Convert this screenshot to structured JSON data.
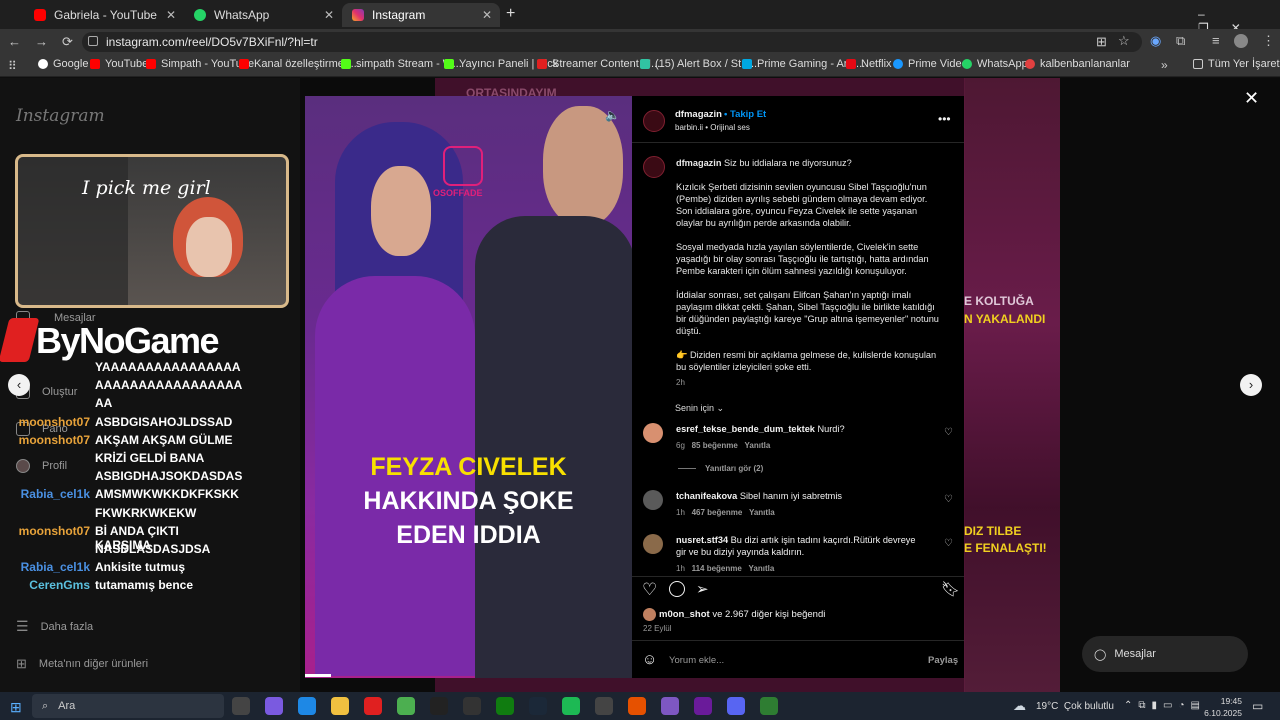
{
  "browser": {
    "tabs": [
      {
        "label": "Gabriela - YouTube",
        "color": "#ff0000"
      },
      {
        "label": "WhatsApp",
        "color": "#25d366"
      },
      {
        "label": "Instagram",
        "color": "#e1306c"
      }
    ],
    "url": "instagram.com/reel/DO5v7BXiFnl/?hl=tr",
    "bookmarks": [
      "Google",
      "YouTube",
      "Simpath - YouTube",
      "Kanal özelleştirme -...",
      "simpath Stream - W...",
      "Yayıncı Paneli | Kick",
      "Streamer Content M...",
      "(15) Alert Box / Stre...",
      "Prime Gaming - Ana...",
      "Netflix",
      "Prime Video",
      "WhatsApp",
      "kalbenbanlananlar"
    ],
    "all_bookmarks": "Tüm Yer İşaretleri"
  },
  "instagram": {
    "logo": "Instagram",
    "nav": {
      "messages": "Mesajlar",
      "create": "Oluştur",
      "dashboard": "Pano",
      "profile": "Profil",
      "more": "Daha fazla",
      "meta": "Meta'nın diğer ürünleri"
    },
    "messages_pill": "Mesajlar"
  },
  "stream": {
    "webcam_text": "I pick me girl",
    "logo": "ByNoGame",
    "chat": [
      {
        "user": "",
        "msg": "YAAAAAAAAAAAAAAAA"
      },
      {
        "user": "",
        "msg": "AAAAAAAAAAAAAAAAA"
      },
      {
        "user": "",
        "msg": "AA"
      },
      {
        "user": "moonshot07",
        "msg": "ASBDGISAHOJLDSSAD",
        "color": "#e8a33a"
      },
      {
        "user": "moonshot07",
        "msg": "AKŞAM AKŞAM GÜLME",
        "color": "#e8a33a"
      },
      {
        "user": "",
        "msg": "KRİZİ GELDİ BANA"
      },
      {
        "user": "",
        "msg": "ASBIGDHAJSOKDASDAS"
      },
      {
        "user": "Rabia_cel1k",
        "msg": "AMSMWKWKKDKFKSKK",
        "color": "#4a90e2"
      },
      {
        "user": "",
        "msg": "FKWKRKWKEKW"
      },
      {
        "user": "moonshot07",
        "msg": "Bİ ANDA ÇIKTI KARŞIMA",
        "color": "#e8a33a"
      },
      {
        "user": "",
        "msg": "NASDLASDASJDSA"
      },
      {
        "user": "Rabia_cel1k",
        "msg": "Ankisite tutmuş",
        "color": "#4a90e2"
      },
      {
        "user": "CerenGms",
        "msg": "tutamamış bence",
        "color": "#5bc0de"
      }
    ]
  },
  "post": {
    "brand": "OSOFFADE",
    "headline": [
      "FEYZA CIVELEK",
      "HAKKINDA ŞOKE",
      "EDEN IDDIA"
    ],
    "author": "dfmagazin",
    "follow": "Takip Et",
    "audio_user": "barbin.ii",
    "audio": "Orijinal ses",
    "caption_lead": "Siz bu iddialara ne diyorsunuz?",
    "caption": [
      "Kızılcık Şerbeti dizisinin sevilen oyuncusu Sibel Taşçıoğlu'nun (Pembe) diziden ayrılış sebebi gündem olmaya devam ediyor. Son iddialara göre, oyuncu Feyza Civelek ile sette yaşanan olaylar bu ayrılığın perde arkasında olabilir.",
      "Sosyal medyada hızla yayılan söylentilerde, Civelek'in sette yaşadığı bir olay sonrası Taşçıoğlu ile tartıştığı, hatta ardından Pembe karakteri için ölüm sahnesi yazıldığı konuşuluyor.",
      "İddialar sonrası, set çalışanı Elifcan Şahan'ın yaptığı imalı paylaşım dikkat çekti. Şahan, Sibel Taşçıoğlu ile birlikte katıldığı bir düğünden paylaştığı kareye \"Grup altına işemeyenler\" notunu düştü.",
      "👉 Diziden resmi bir açıklama gelmese de, kulislerde konuşulan bu söylentiler izleyicileri şoke etti."
    ],
    "time": "2h",
    "sort": "Senin için",
    "comments": [
      {
        "user": "esref_tekse_bende_dum_tektek",
        "text": "Nurdi?",
        "time": "6g",
        "likes": "85 beğenme",
        "reply": "Yanıtla",
        "view_replies": "Yanıtları gör (2)"
      },
      {
        "user": "tchanifeakova",
        "text": "Sibel hanım iyi sabretmis",
        "time": "1h",
        "likes": "467 beğenme",
        "reply": "Yanıtla"
      },
      {
        "user": "nusret.stf34",
        "text": "Bu dizi artık işin tadını kaçırdı.Rütürk devreye gir ve bu diziyi yayında kaldırın.",
        "time": "1h",
        "likes": "114 beğenme",
        "reply": "Yanıtla"
      }
    ],
    "liked_by_user": "m0on_shot",
    "liked_by_rest": "ve 2.967 diğer kişi beğendi",
    "date": "22 Eylül",
    "comment_placeholder": "Yorum ekle...",
    "share": "Paylaş"
  },
  "bg": {
    "right1": "E KOLTUĞA",
    "right2": "N YAKALANDI",
    "right3": "DIZ TILBE",
    "right4": "E FENALAŞTI!",
    "top": "ORTASINDAYIM"
  },
  "taskbar": {
    "search": "Ara",
    "weather_temp": "19°C",
    "weather": "Çok bulutlu",
    "time": "19:45",
    "date": "6.10.2025"
  }
}
